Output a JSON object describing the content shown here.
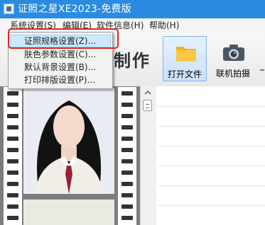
{
  "window": {
    "title": "证照之星XE2023-免费版"
  },
  "menubar": {
    "items": [
      {
        "label": "系统设置(S)"
      },
      {
        "label": "编辑(E)"
      },
      {
        "label": "软件信息(H)"
      },
      {
        "label": "帮助(H)"
      }
    ]
  },
  "dropdown": {
    "items": [
      {
        "label": "证照规格设置(Z)..."
      },
      {
        "label": "肤色参数设置(C)..."
      },
      {
        "label": "默认背景设置(B)..."
      },
      {
        "label": "打印排版设置(P)..."
      }
    ],
    "highlighted_index": 0
  },
  "toolbar": {
    "heading_fragment": "制作",
    "open_label": "打开文件",
    "shoot_label": "联机拍摄"
  },
  "colors": {
    "titlebar": "#2a8be0",
    "highlight": "#cce8ff",
    "annotation": "#e02424",
    "photo_background": "#e9ecf3"
  }
}
